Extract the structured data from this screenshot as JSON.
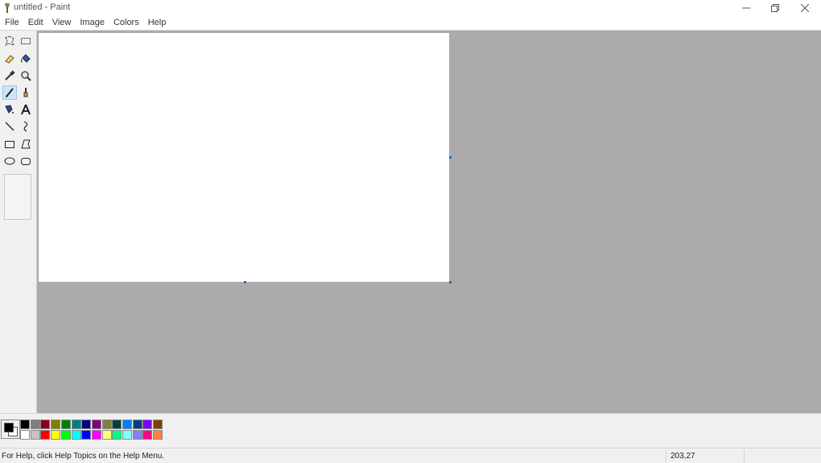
{
  "window": {
    "title": "untitled - Paint"
  },
  "menu": [
    "File",
    "Edit",
    "View",
    "Image",
    "Colors",
    "Help"
  ],
  "tools": [
    "free-form-select-icon",
    "select-icon",
    "eraser-icon",
    "fill-bucket-icon",
    "pick-color-icon",
    "magnifier-icon",
    "pencil-icon",
    "brush-icon",
    "airbrush-icon",
    "text-icon",
    "line-icon",
    "curve-icon",
    "rectangle-icon",
    "polygon-icon",
    "ellipse-icon",
    "rounded-rectangle-icon"
  ],
  "active_tool": "pencil-icon",
  "colors": {
    "foreground": "#000000",
    "background": "#ffffff",
    "palette_top": [
      "#000000",
      "#7f7f7f",
      "#880015",
      "#808000",
      "#008000",
      "#008080",
      "#000080",
      "#800080",
      "#808040",
      "#004040",
      "#0080ff",
      "#004080",
      "#8000ff",
      "#804000"
    ],
    "palette_bottom": [
      "#ffffff",
      "#c3c3c3",
      "#ff0000",
      "#ffff00",
      "#00ff00",
      "#00ffff",
      "#0000ff",
      "#ff00ff",
      "#ffff80",
      "#00ff80",
      "#80ffff",
      "#8080ff",
      "#ff0080",
      "#ff8040"
    ]
  },
  "status": {
    "help_text": "For Help, click Help Topics on the Help Menu.",
    "coordinates": "203,27"
  }
}
